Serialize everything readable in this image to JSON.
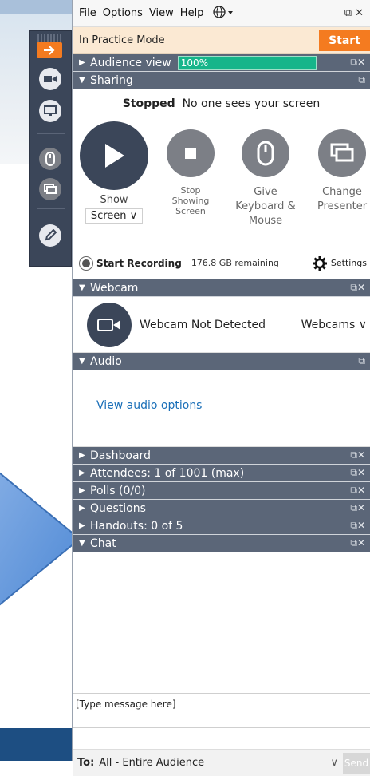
{
  "menubar": {
    "file": "File",
    "options": "Options",
    "view": "View",
    "help": "Help"
  },
  "practice": {
    "mode_text": "In Practice Mode",
    "start_label": "Start"
  },
  "sections": {
    "audience_view": "Audience view",
    "audience_level": "100%",
    "sharing": "Sharing",
    "webcam": "Webcam",
    "audio": "Audio",
    "dashboard": "Dashboard",
    "attendees": "Attendees: 1 of 1001 (max)",
    "polls": "Polls (0/0)",
    "questions": "Questions",
    "handouts": "Handouts: 0 of 5",
    "chat": "Chat"
  },
  "sharing": {
    "status_bold": "Stopped",
    "status_rest": "No one sees your screen",
    "show_label": "Show",
    "screen_select": "Screen",
    "stop_label_1": "Stop",
    "stop_label_2": "Showing",
    "stop_label_3": "Screen",
    "give_label_1": "Give",
    "give_label_2": "Keyboard &",
    "give_label_3": "Mouse",
    "change_label_1": "Change",
    "change_label_2": "Presenter"
  },
  "recording": {
    "title": "Start Recording",
    "remaining": "176.8 GB remaining",
    "settings": "Settings"
  },
  "webcam": {
    "status": "Webcam Not Detected",
    "select": "Webcams"
  },
  "audio": {
    "link": "View audio options"
  },
  "chat": {
    "placeholder": "[Type message here]",
    "to_label": "To:",
    "to_value": "All - Entire Audience",
    "send": "Send"
  },
  "colors": {
    "accent_orange": "#f47b20",
    "header_slate": "#5b6678",
    "toolbar": "#3b4659",
    "level_green": "#16b58a",
    "link_blue": "#1a6fb8"
  }
}
